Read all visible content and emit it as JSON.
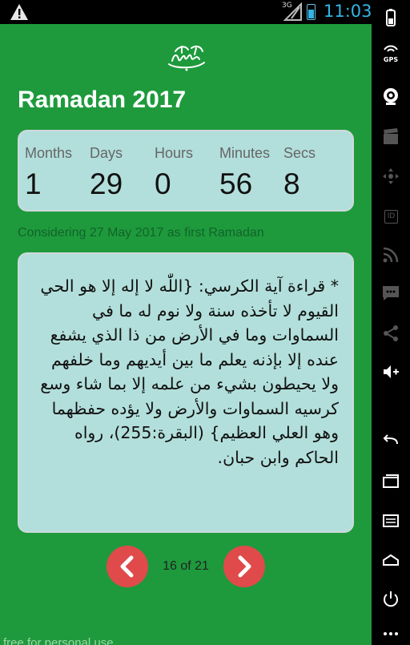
{
  "status_bar": {
    "network": "3G",
    "time": "11:03"
  },
  "app": {
    "title": "Ramadan 2017",
    "countdown": [
      {
        "label": "Months",
        "value": "1"
      },
      {
        "label": "Days",
        "value": "29"
      },
      {
        "label": "Hours",
        "value": "0"
      },
      {
        "label": "Minutes",
        "value": "56"
      },
      {
        "label": "Secs",
        "value": "8"
      }
    ],
    "note": "Considering 27 May 2017 as first Ramadan",
    "dua": "* قراءة آية الكرسي: {اللّٰه لا إله إلا هو الحي القيوم لا تأخذه سنة ولا نوم له ما في السماوات وما في الأرض من ذا الذي يشفع عنده إلا بإذنه يعلم ما بين أيديهم وما خلفهم ولا يحيطون بشيء من علمه إلا بما شاء وسع كرسيه السماوات والأرض ولا يؤده حفظهما وهو العلي العظيم} (البقرة:255)، رواه الحاكم وابن حبان.",
    "page_indicator": "16 of 21",
    "watermark": "free for personal use"
  },
  "nav_bar": {
    "gps_label": "GPS",
    "id_label": "ID"
  },
  "colors": {
    "app_background": "#1e9a3c",
    "card_background": "#b2dfdb",
    "nav_button": "#e04a4a",
    "clock": "#33b5e5"
  },
  "icons": {
    "status_warning": "warning-icon",
    "prev": "chevron-left-icon",
    "next": "chevron-right-icon",
    "emblem": "calligraphy-emblem-icon"
  }
}
